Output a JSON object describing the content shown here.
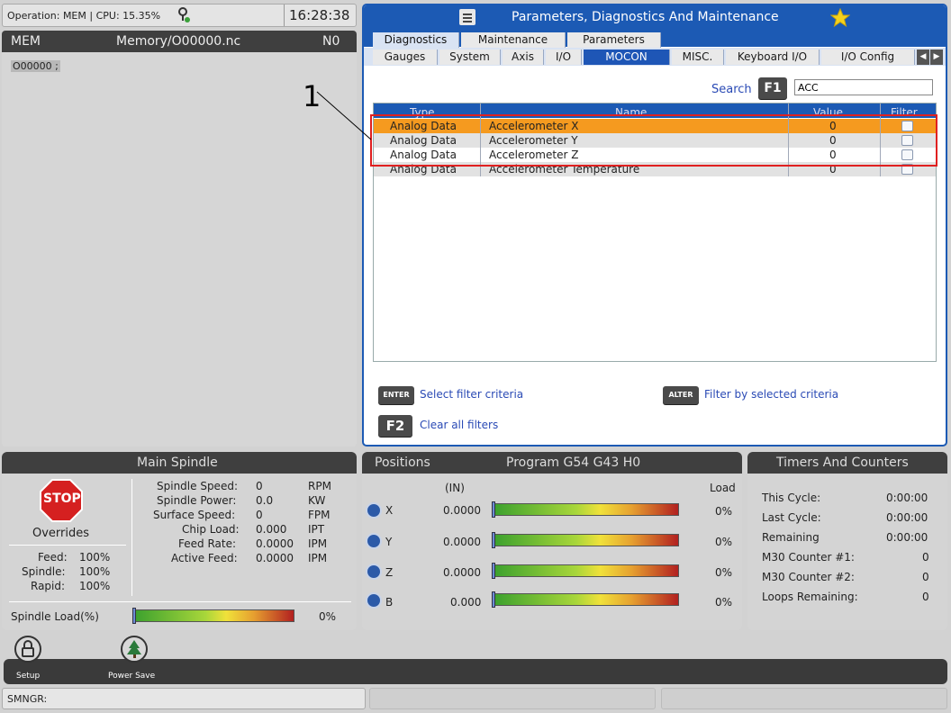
{
  "status": {
    "operation": "Operation: MEM | CPU: 15.35%",
    "time": "16:28:38"
  },
  "program": {
    "mode": "MEM",
    "file": "Memory/O00000.nc",
    "line": "N0",
    "code": "O00000 ;"
  },
  "pdm": {
    "title": "Parameters, Diagnostics And Maintenance",
    "top_tabs": [
      "Diagnostics",
      "Maintenance",
      "Parameters"
    ],
    "sub_tabs": [
      "Gauges",
      "System",
      "Axis",
      "I/O",
      "MOCON",
      "MISC.",
      "Keyboard I/O",
      "I/O Config"
    ],
    "search_label": "Search",
    "search_key": "F1",
    "search_value": "ACC",
    "columns": [
      "Type",
      "Name",
      "Value",
      "Filter"
    ],
    "rows": [
      {
        "type": "Analog Data",
        "name": "Accelerometer X",
        "value": "0"
      },
      {
        "type": "Analog Data",
        "name": "Accelerometer Y",
        "value": "0"
      },
      {
        "type": "Analog Data",
        "name": "Accelerometer Z",
        "value": "0"
      },
      {
        "type": "Analog Data",
        "name": "Accelerometer Temperature",
        "value": "0"
      }
    ],
    "callout": "1",
    "enter_key": "ENTER",
    "enter_label": "Select filter criteria",
    "alter_key": "ALTER",
    "alter_label": "Filter by selected criteria",
    "f2_key": "F2",
    "f2_label": "Clear all filters"
  },
  "spindle": {
    "title": "Main Spindle",
    "stop": "STOP",
    "overrides": "Overrides",
    "ov": [
      {
        "k": "Feed:",
        "v": "100%"
      },
      {
        "k": "Spindle:",
        "v": "100%"
      },
      {
        "k": "Rapid:",
        "v": "100%"
      }
    ],
    "stats": [
      {
        "k": "Spindle Speed:",
        "v": "0",
        "u": "RPM"
      },
      {
        "k": "Spindle Power:",
        "v": "0.0",
        "u": "KW"
      },
      {
        "k": "Surface Speed:",
        "v": "0",
        "u": "FPM"
      },
      {
        "k": "Chip Load:",
        "v": "0.000",
        "u": "IPT"
      },
      {
        "k": "Feed Rate:",
        "v": "0.0000",
        "u": "IPM"
      },
      {
        "k": "Active Feed:",
        "v": "0.0000",
        "u": "IPM"
      }
    ],
    "load_label": "Spindle Load(%)",
    "load_value": "0%",
    "load_fraction": 0
  },
  "positions": {
    "title": "Positions",
    "program": "Program G54 G43 H0",
    "unit": "(IN)",
    "load_header": "Load",
    "axes": [
      {
        "axis": "X",
        "value": "0.0000",
        "load": "0%"
      },
      {
        "axis": "Y",
        "value": "0.0000",
        "load": "0%"
      },
      {
        "axis": "Z",
        "value": "0.0000",
        "load": "0%"
      },
      {
        "axis": "B",
        "value": "0.000",
        "load": "0%"
      }
    ]
  },
  "timers": {
    "title": "Timers And Counters",
    "rows": [
      {
        "k": "This Cycle:",
        "v": "0:00:00"
      },
      {
        "k": "Last Cycle:",
        "v": "0:00:00"
      },
      {
        "k": "Remaining",
        "v": "0:00:00"
      },
      {
        "k": "M30 Counter #1:",
        "v": "0"
      },
      {
        "k": "M30 Counter #2:",
        "v": "0"
      },
      {
        "k": "Loops Remaining:",
        "v": "0"
      }
    ]
  },
  "dock": {
    "setup": "Setup",
    "power_save": "Power Save"
  },
  "footer": {
    "smngr": "SMNGR:"
  },
  "colors": {
    "accent": "#1c5ab4",
    "selected_row": "#f59a1f",
    "callout_box": "#e02020"
  }
}
